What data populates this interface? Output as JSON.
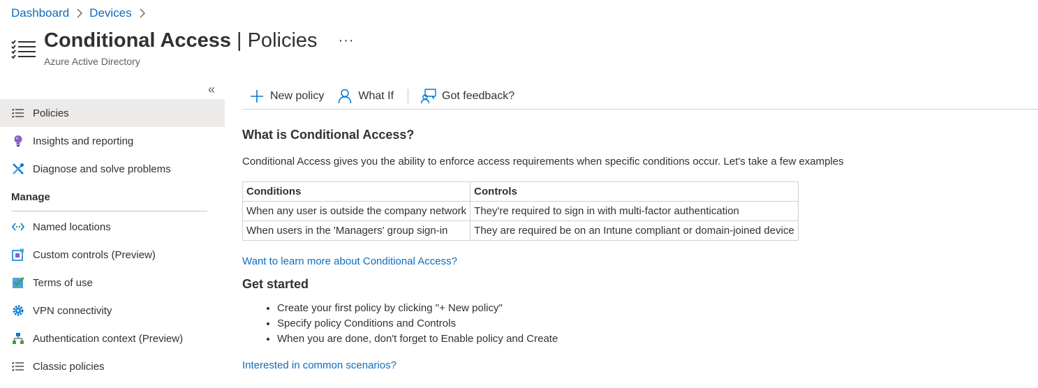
{
  "breadcrumb": {
    "items": [
      "Dashboard",
      "Devices"
    ]
  },
  "header": {
    "title": "Conditional Access",
    "separator": "|",
    "subtitle_section": "Policies",
    "more": "···",
    "service": "Azure Active Directory",
    "icon": "list-icon"
  },
  "sidebar": {
    "collapse_glyph": "«",
    "items": [
      {
        "label": "Policies",
        "icon": "list-icon",
        "active": true
      },
      {
        "label": "Insights and reporting",
        "icon": "lightbulb-icon"
      },
      {
        "label": "Diagnose and solve problems",
        "icon": "wrench-icon"
      }
    ],
    "manage_label": "Manage",
    "manage_items": [
      {
        "label": "Named locations",
        "icon": "network-icon"
      },
      {
        "label": "Custom controls (Preview)",
        "icon": "custom-controls-icon"
      },
      {
        "label": "Terms of use",
        "icon": "checklist-icon"
      },
      {
        "label": "VPN connectivity",
        "icon": "gear-icon"
      },
      {
        "label": "Authentication context (Preview)",
        "icon": "hierarchy-icon"
      },
      {
        "label": "Classic policies",
        "icon": "list-icon"
      }
    ]
  },
  "toolbar": {
    "new_policy": "New policy",
    "what_if": "What If",
    "feedback": "Got feedback?"
  },
  "main": {
    "heading": "What is Conditional Access?",
    "description": "Conditional Access gives you the ability to enforce access requirements when specific conditions occur. Let's take a few examples",
    "table": {
      "headers": [
        "Conditions",
        "Controls"
      ],
      "rows": [
        [
          "When any user is outside the company network",
          "They're required to sign in with multi-factor authentication"
        ],
        [
          "When users in the 'Managers' group sign-in",
          "They are required be on an Intune compliant or domain-joined device"
        ]
      ]
    },
    "learn_more_link": "Want to learn more about Conditional Access?",
    "get_started_heading": "Get started",
    "steps": [
      "Create your first policy by clicking \"+ New policy\"",
      "Specify policy Conditions and Controls",
      "When you are done, don't forget to Enable policy and Create"
    ],
    "scenarios_link": "Interested in common scenarios?"
  },
  "colors": {
    "link": "#0f6cbd",
    "active_bg": "#edebe9",
    "text": "#323130"
  }
}
